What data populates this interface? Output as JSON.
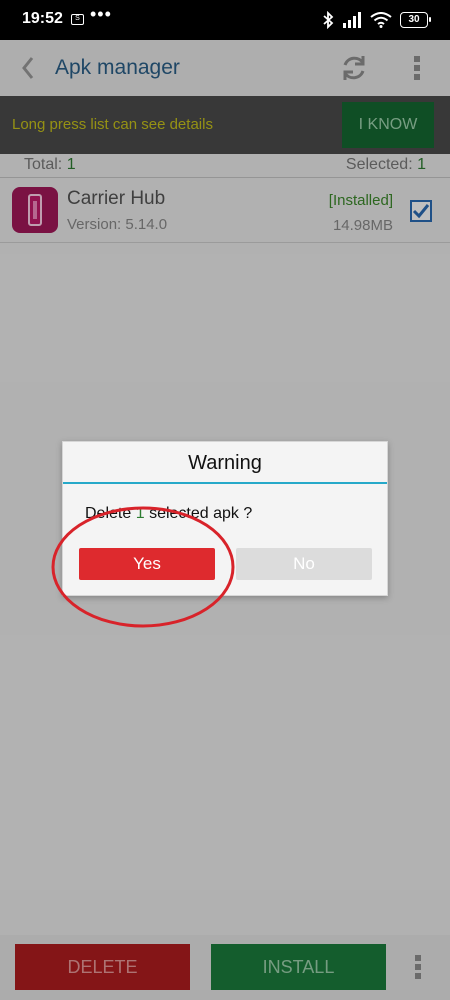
{
  "status_bar": {
    "time": "19:52",
    "chip_label": "S",
    "dots": "•••",
    "battery": "30"
  },
  "app_bar": {
    "title": "Apk manager",
    "back_icon": "chevron-left-icon",
    "refresh_icon": "refresh-icon",
    "menu_icon": "more-vertical-icon"
  },
  "hint": {
    "text": "Long press list can see details",
    "button_label": "I KNOW"
  },
  "totals": {
    "total_label": "Total:",
    "total_value": "1",
    "selected_label": "Selected:",
    "selected_value": "1"
  },
  "apps": [
    {
      "name": "Carrier Hub",
      "version": "Version: 5.14.0",
      "status": "[Installed]",
      "size": "14.98MB",
      "checked": true
    }
  ],
  "dialog": {
    "title": "Warning",
    "message_prefix": "Delete",
    "message_count": "1",
    "message_suffix": "selected apk ?",
    "yes_label": "Yes",
    "no_label": "No"
  },
  "bottom_bar": {
    "delete_label": "DELETE",
    "install_label": "INSTALL"
  },
  "colors": {
    "accent": "#2a5f88",
    "danger": "#de2a2e",
    "success": "#1b7c3d",
    "annotation": "#d8232a"
  }
}
